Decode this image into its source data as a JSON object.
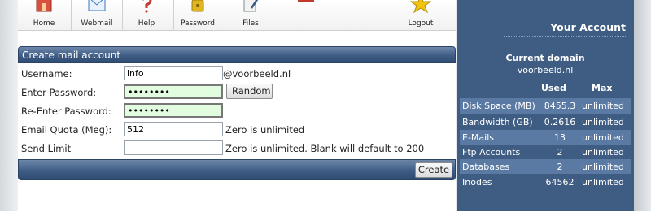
{
  "toolbar": {
    "items": [
      {
        "label": "Home",
        "icon": "home-icon",
        "color": "#c0392b"
      },
      {
        "label": "Webmail",
        "icon": "webmail-icon",
        "color": "#3a7bbf"
      },
      {
        "label": "Help",
        "icon": "help-icon",
        "color": "#c0392b"
      },
      {
        "label": "Password",
        "icon": "lock-icon",
        "color": "#e1b520"
      },
      {
        "label": "Files",
        "icon": "files-icon",
        "color": "#7f8c8d"
      },
      {
        "label": "Logout",
        "icon": "star-icon",
        "color": "#f1c40f"
      }
    ]
  },
  "form": {
    "header": "Create mail account",
    "username": {
      "label": "Username:",
      "value": "info",
      "suffix": "@voorbeeld.nl"
    },
    "password": {
      "label": "Enter Password:",
      "value": "••••••••",
      "random_button": "Random"
    },
    "repassword": {
      "label": "Re-Enter Password:",
      "value": "••••••••"
    },
    "quota": {
      "label": "Email Quota (Meg):",
      "value": "512",
      "note": "Zero is unlimited"
    },
    "sendlimit": {
      "label": "Send Limit",
      "value": "",
      "note": "Zero is unlimited. Blank will default to 200"
    },
    "create_button": "Create"
  },
  "sidebar": {
    "title": "Your Account",
    "current_domain_heading": "Current domain",
    "current_domain": "voorbeeld.nl",
    "col_used": "Used",
    "col_max": "Max",
    "rows": [
      {
        "name": "Disk Space (MB)",
        "used": "8455.3",
        "max": "unlimited"
      },
      {
        "name": "Bandwidth (GB)",
        "used": "0.2616",
        "max": "unlimited"
      },
      {
        "name": "E-Mails",
        "used": "13",
        "max": "unlimited"
      },
      {
        "name": "Ftp Accounts",
        "used": "2",
        "max": "unlimited"
      },
      {
        "name": "Databases",
        "used": "2",
        "max": "unlimited"
      },
      {
        "name": "Inodes",
        "used": "64562",
        "max": "unlimited"
      }
    ]
  }
}
